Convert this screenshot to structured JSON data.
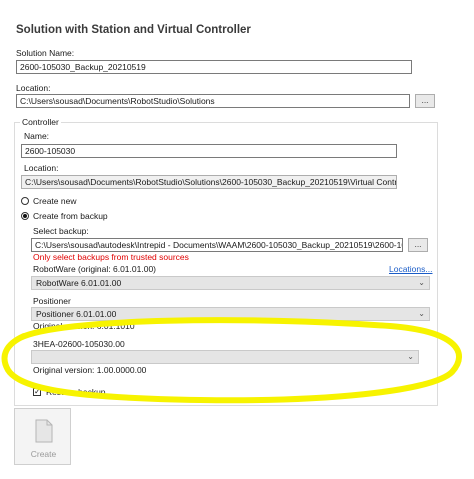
{
  "dialog": {
    "title": "Solution with Station and Virtual Controller"
  },
  "solution": {
    "name_label": "Solution Name:",
    "name_value": "2600-105030_Backup_20210519",
    "location_label": "Location:",
    "location_value": "C:\\Users\\sousad\\Documents\\RobotStudio\\Solutions",
    "browse_label": "..."
  },
  "controller": {
    "group_label": "Controller",
    "name_label": "Name:",
    "name_value": "2600-105030",
    "location_label": "Location:",
    "location_value": "C:\\Users\\sousad\\Documents\\RobotStudio\\Solutions\\2600-105030_Backup_20210519\\Virtual Controllers",
    "create_new_label": "Create new",
    "create_from_backup_label": "Create from backup",
    "mode_selected": "Create from backup",
    "select_backup_label": "Select backup:",
    "backup_path": "C:\\Users\\sousad\\autodesk\\Intrepid - Documents\\WAAM\\2600-105030_Backup_20210519\\2600-105030_Ba",
    "browse_label": "...",
    "trusted_warning": "Only select backups from trusted sources",
    "robotware_label": "RobotWare (original: 6.01.01.00)",
    "locations_link": "Locations...",
    "robotware_selected": "RobotWare 6.01.01.00",
    "positioner_label": "Positioner",
    "positioner_selected": "Positioner 6.01.01.00",
    "positioner_original": "Original version: 6.01.1010",
    "addin_label": "3HEA-02600-105030.00",
    "addin_selected": "",
    "addin_original": "Original version: 1.00.0000.00",
    "restore_backup_label": "Restore backup",
    "restore_backup_checked": true
  },
  "actions": {
    "create_label": "Create"
  },
  "annotation": {
    "highlight_color": "#f7f300"
  }
}
